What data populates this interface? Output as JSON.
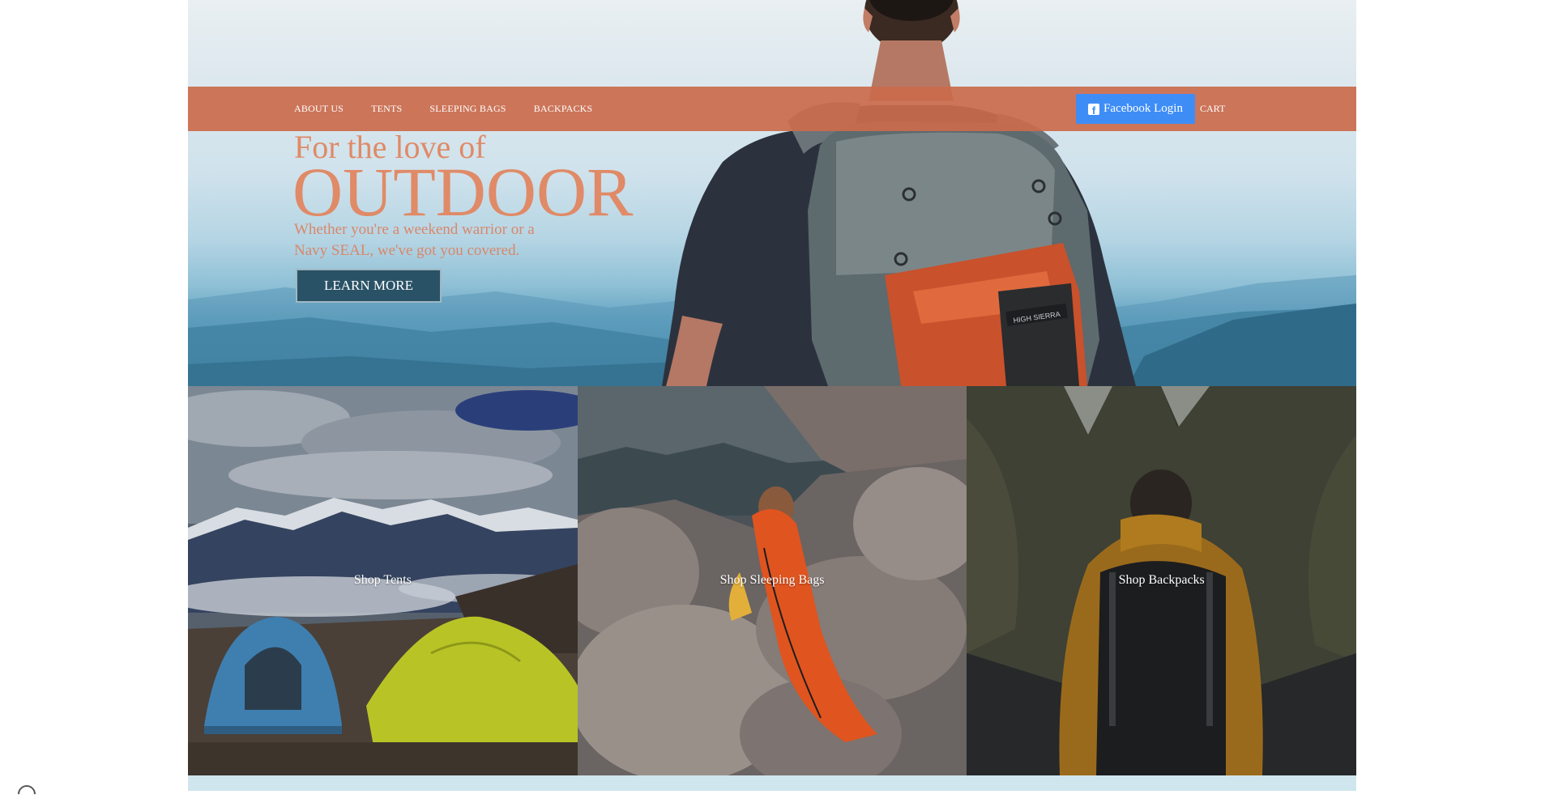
{
  "nav": {
    "links": [
      "ABOUT US",
      "TENTS",
      "SLEEPING BAGS",
      "BACKPACKS"
    ],
    "facebook_login": "Facebook Login",
    "facebook_icon": "facebook-icon",
    "cart": "CART"
  },
  "hero": {
    "tagline": "For the love of",
    "title": "OUTDOOR",
    "subtitle": "Whether you're a weekend warrior or a Navy SEAL, we've got you covered.",
    "cta": "LEARN MORE",
    "backpack_brand": "HIGH SIERRA"
  },
  "tiles": [
    {
      "label": "Shop Tents"
    },
    {
      "label": "Shop Sleeping Bags"
    },
    {
      "label": "Shop Backpacks"
    }
  ],
  "colors": {
    "nav_bg": "#cb6b4c",
    "accent_text": "#e08a67",
    "cta_bg": "#2a5266",
    "facebook_blue": "#3e8df7"
  }
}
